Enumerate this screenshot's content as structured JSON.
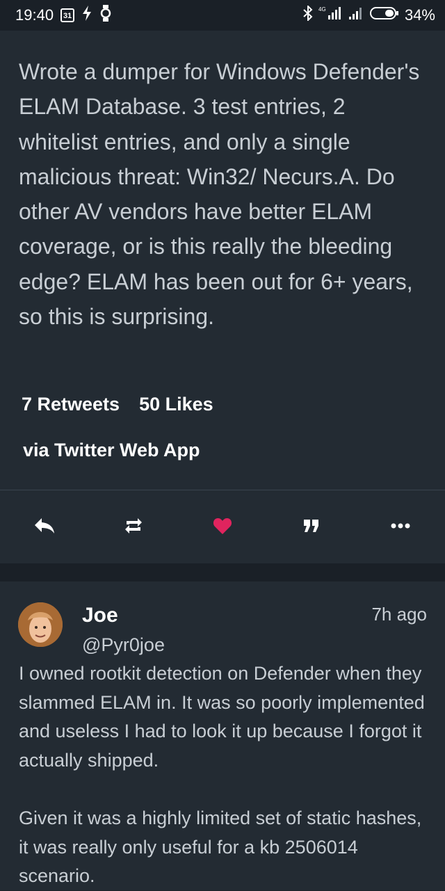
{
  "status_bar": {
    "time": "19:40",
    "calendar_day": "31",
    "network": "4G",
    "battery": "34%"
  },
  "tweet": {
    "text": "Wrote a dumper for Windows Defender's ELAM Database. 3 test entries, 2 whitelist entries, and only a single malicious threat: Win32/ Necurs.A. Do other AV vendors have better ELAM coverage, or is this really the bleeding edge? ELAM has been out for 6+ years, so this is surprising.",
    "retweets": "7 Retweets",
    "likes": "50 Likes",
    "via": "via Twitter Web App"
  },
  "actions": {
    "icons": [
      "reply-icon",
      "retweet-icon",
      "heart-icon",
      "quote-icon",
      "more-icon"
    ],
    "like_color": "#e0245e"
  },
  "reply": {
    "name": "Joe",
    "handle": "@Pyr0joe",
    "time": "7h ago",
    "paragraph_1": "I owned rootkit detection on Defender when they slammed ELAM in. It was so poorly implemented and useless I had to look it up because I forgot it actually shipped.",
    "paragraph_2": "Given it was a highly limited set of static hashes, it was really only useful for a kb 2506014 scenario."
  },
  "colors": {
    "background": "#232b33",
    "status_bar": "#1a2027",
    "text_secondary": "#c8ced4"
  }
}
